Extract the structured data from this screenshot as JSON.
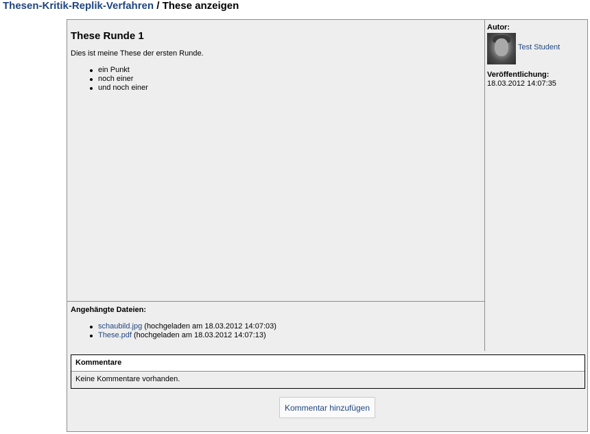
{
  "header": {
    "link": "Thesen-Kritik-Replik-Verfahren",
    "separator": " / ",
    "current": "These anzeigen"
  },
  "thesis": {
    "title": "These Runde 1",
    "text": "Dies ist meine These der ersten Runde.",
    "bullets": [
      "ein Punkt",
      "noch einer",
      "und noch einer"
    ]
  },
  "attachments": {
    "heading": "Angehängte Dateien:",
    "files": [
      {
        "name": "schaubild.jpg",
        "info": " (hochgeladen am 18.03.2012 14:07:03)"
      },
      {
        "name": "These.pdf",
        "info": " (hochgeladen am 18.03.2012 14:07:13)"
      }
    ]
  },
  "sidebar": {
    "author_label": "Autor:",
    "author_name": "Test Student",
    "published_label": "Veröffentlichung:",
    "published_date": "18.03.2012 14:07:35"
  },
  "comments": {
    "heading": "Kommentare",
    "empty_text": "Keine Kommentare vorhanden.",
    "add_button": "Kommentar hinzufügen"
  },
  "colors": {
    "link": "#1f4580",
    "panel_bg": "#eeeeee",
    "border": "#8c8c8c"
  }
}
